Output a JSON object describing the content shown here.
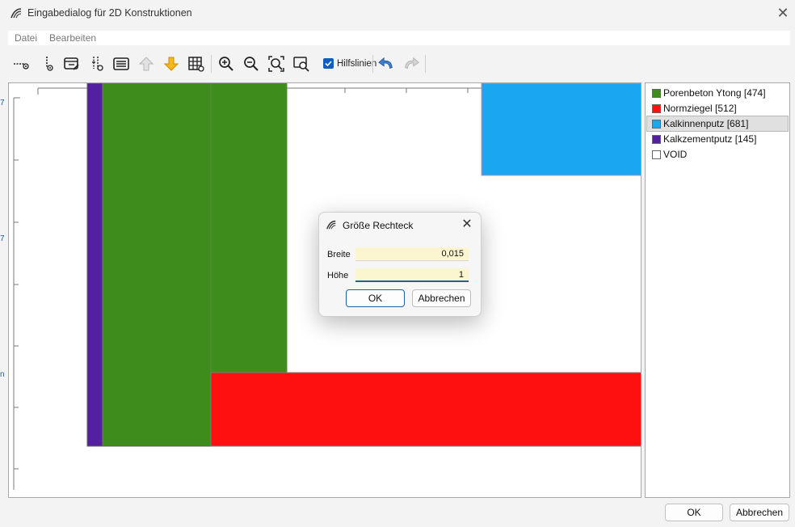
{
  "window": {
    "title": "Eingabedialog für 2D Konstruktionen",
    "close_glyph": "✕"
  },
  "menu": {
    "items": [
      "Datei",
      "Bearbeiten"
    ]
  },
  "toolbar": {
    "hilfslinien_label": "Hilfslinien",
    "hilfslinien_checked": true,
    "icons": [
      "horizontal-line-icon",
      "vertical-line-icon",
      "edit-field-icon",
      "split-vertical-icon",
      "list-dialog-icon",
      "move-up-icon",
      "move-down-icon",
      "grid-table-icon",
      "zoom-in-icon",
      "zoom-out-icon",
      "zoom-fit-icon",
      "zoom-window-icon",
      "undo-icon",
      "redo-icon"
    ]
  },
  "legend": {
    "selected_index": 2,
    "items": [
      {
        "label": "Porenbeton Ytong [474]",
        "color": "#3d8c1c"
      },
      {
        "label": "Normziegel [512]",
        "color": "#ff1010"
      },
      {
        "label": "Kalkinnenputz [681]",
        "color": "#1aa7f2"
      },
      {
        "label": "Kalkzementputz [145]",
        "color": "#5520a0"
      },
      {
        "label": "VOID",
        "color": "#ffffff"
      }
    ]
  },
  "canvas_colors": {
    "porenbeton": "#3d8c1c",
    "normziegel": "#ff1010",
    "kalkinnenputz": "#1aa7f2",
    "kalkzementputz": "#5520a0"
  },
  "dialog": {
    "title": "Größe Rechteck",
    "close_glyph": "✕",
    "breite_label": "Breite",
    "breite_value": "0,015",
    "hoehe_label": "Höhe",
    "hoehe_value": "1",
    "ok_label": "OK",
    "cancel_label": "Abbrechen"
  },
  "footer": {
    "ok_label": "OK",
    "cancel_label": "Abbrechen"
  }
}
